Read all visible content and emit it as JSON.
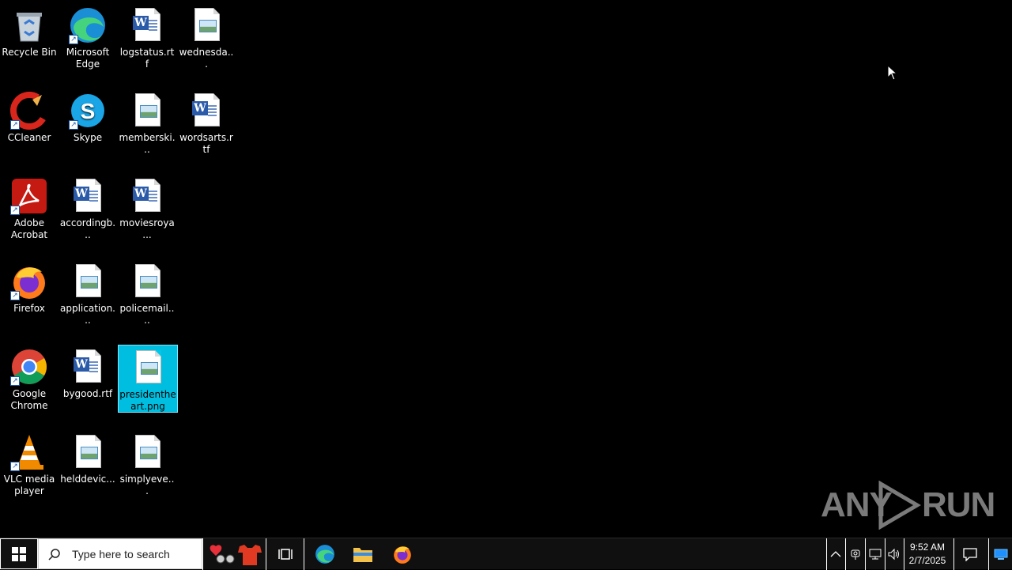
{
  "desktop": {
    "icons": [
      {
        "label": "Recycle Bin"
      },
      {
        "label": "Microsoft Edge"
      },
      {
        "label": "logstatus.rtf"
      },
      {
        "label": "wednesda..."
      },
      {
        "label": "CCleaner"
      },
      {
        "label": "Skype"
      },
      {
        "label": "memberski..."
      },
      {
        "label": "wordsarts.rtf"
      },
      {
        "label": "Adobe Acrobat"
      },
      {
        "label": "accordingb..."
      },
      {
        "label": "moviesroya..."
      },
      {
        "label": "Firefox"
      },
      {
        "label": "application..."
      },
      {
        "label": "policemail...."
      },
      {
        "label": "Google Chrome"
      },
      {
        "label": "bygood.rtf"
      },
      {
        "label": "presidentheart.png"
      },
      {
        "label": "VLC media player"
      },
      {
        "label": "helddevic..."
      },
      {
        "label": "simplyeve..."
      }
    ],
    "selected_icon": "presidentheart.png"
  },
  "watermark": {
    "left_text": "ANY",
    "right_text": "RUN"
  },
  "taskbar": {
    "search_placeholder": "Type here to search",
    "pinned": [
      "task-view",
      "microsoft-edge",
      "file-explorer",
      "firefox"
    ],
    "clock": {
      "time": "9:52 AM",
      "date": "2/7/2025"
    }
  },
  "colors": {
    "selection": "#00c8eb",
    "taskbar": "#101010",
    "desktop": "#000000"
  }
}
